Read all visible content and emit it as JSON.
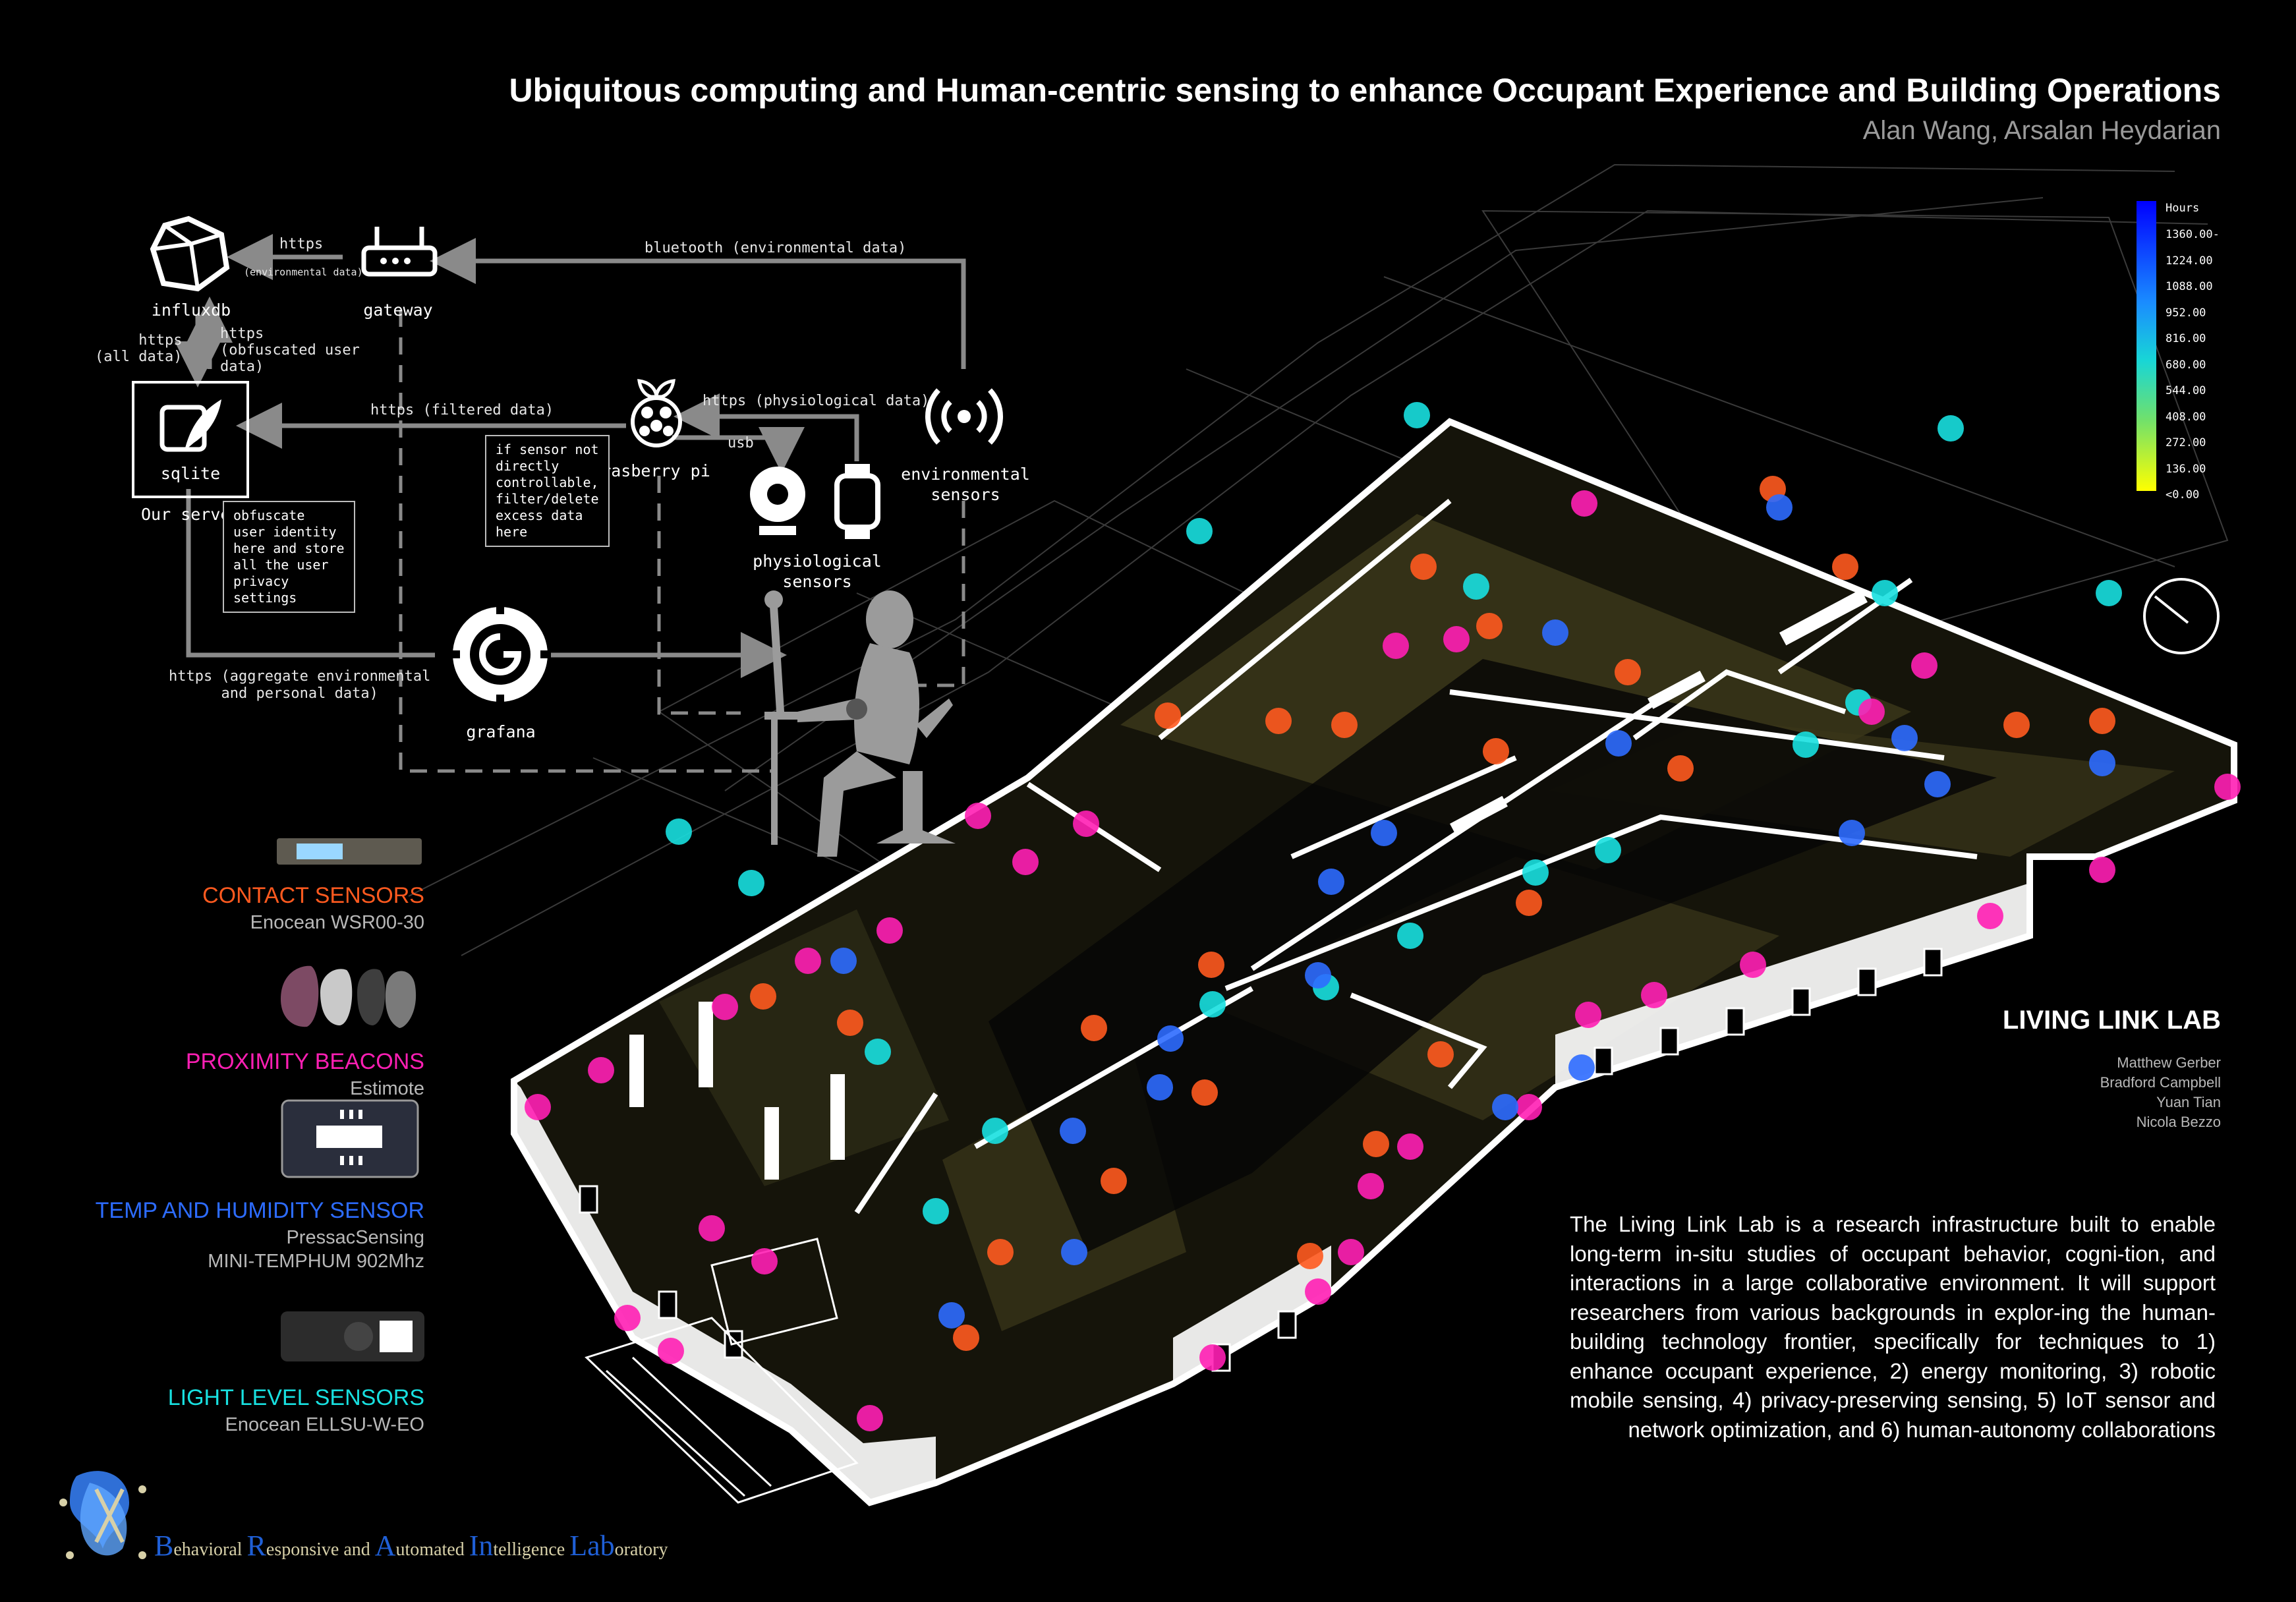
{
  "header": {
    "title": "Ubiquitous computing and Human-centric sensing to enhance Occupant Experience and Building Operations",
    "authors": "Alan Wang, Arsalan Heydarian"
  },
  "architecture": {
    "nodes": {
      "influxdb": "influxdb",
      "gateway": "gateway",
      "sqlite": "sqlite",
      "our_server": "Our server",
      "raspberry_pi": "rasberry pi",
      "environmental_sensors": "environmental\nsensors",
      "physiological_sensors": "physiological\nsensors",
      "grafana": "grafana"
    },
    "edges": {
      "https_top": "https",
      "env_data_small": "(environmental data)",
      "bluetooth": "bluetooth (environmental data)",
      "https_all": "https\n(all data)",
      "https_obfuscated": "https\n(obfuscated user\ndata)",
      "https_filtered": "https (filtered data)",
      "https_physio": "https (physiological data)",
      "usb": "usb",
      "https_aggregate": "https (aggregate environmental\nand personal data)"
    },
    "notes": {
      "obfuscate": "obfuscate\nuser identity\nhere and store\nall the user\nprivacy\nsettings",
      "filter": "if sensor not\ndirectly\ncontrollable,\nfilter/delete\nexcess data\nhere"
    }
  },
  "sensors": [
    {
      "title": "CONTACT SENSORS",
      "sub": "Enocean WSR00-30",
      "color": "#ff5a1f"
    },
    {
      "title": "PROXIMITY BEACONS",
      "sub": "Estimote",
      "color": "#ff1fb4"
    },
    {
      "title": "TEMP AND HUMIDITY SENSOR",
      "sub": "PressacSensing\nMINI-TEMPHUM 902Mhz",
      "color": "#2d6cff"
    },
    {
      "title": "LIGHT LEVEL SENSORS",
      "sub": "Enocean ELLSU-W-EO",
      "color": "#18e0e0"
    }
  ],
  "legend": {
    "title": "Hours",
    "ticks": [
      "1360.00-",
      "1224.00",
      "1088.00",
      "952.00",
      "816.00",
      "680.00",
      "544.00",
      "408.00",
      "272.00",
      "136.00",
      "<0.00"
    ]
  },
  "lab": {
    "name": "LIVING LINK LAB",
    "members": [
      "Matthew Gerber",
      "Bradford Campbell",
      "Yuan Tian",
      "Nicola Bezzo"
    ],
    "description": "The Living Link Lab is a research infrastructure built to enable long-term in-situ studies of occupant behavior, cogni-tion, and interactions in a large collaborative environment. It will support researchers from various backgrounds in explor-ing the human-building technology frontier, specifically for techniques to 1) enhance occupant experience, 2) energy monitoring, 3) robotic mobile sensing, 4) privacy-preserving sensing, 5) IoT sensor and network optimization, and 6) human-autonomy collaborations"
  },
  "brail": {
    "parts": [
      {
        "cap": "B",
        "rest": "ehavioral "
      },
      {
        "cap": "R",
        "rest": "esponsive and "
      },
      {
        "cap": "A",
        "rest": "utomated "
      },
      {
        "cap": "In",
        "rest": "telligence "
      },
      {
        "cap": "Lab",
        "rest": "oratory"
      }
    ]
  },
  "colors": {
    "contact": "#ff5a1f",
    "proximity": "#ff1fb4",
    "temp": "#2d6cff",
    "light": "#18e0e0",
    "wall": "#ffffff",
    "room_fill": "#4a4520"
  }
}
